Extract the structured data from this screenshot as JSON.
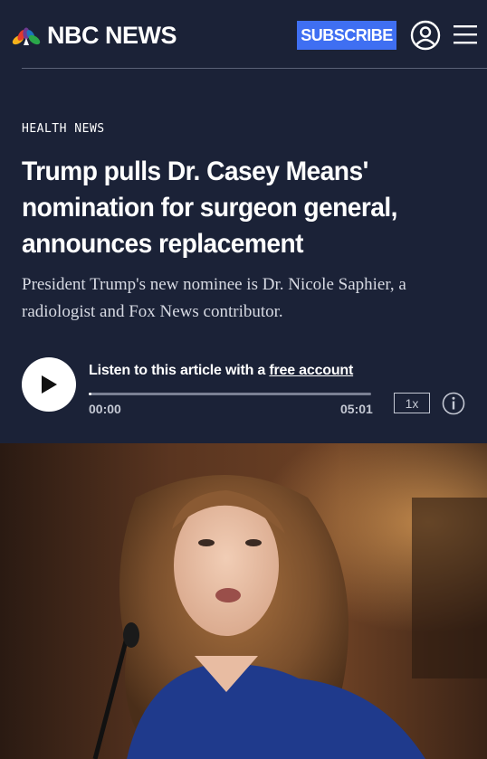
{
  "header": {
    "logo_text": "NBC NEWS",
    "subscribe_label": "SUBSCRIBE",
    "account_icon": "account-icon",
    "menu_icon": "hamburger-menu-icon"
  },
  "article": {
    "kicker": "HEALTH NEWS",
    "headline": "Trump pulls Dr. Casey Means' nomination for surgeon general, announces replacement",
    "dek": "President Trump's new nominee is Dr. Nicole Saphier, a radiologist and Fox News contributor."
  },
  "audio": {
    "listen_text": "Listen to this article with a ",
    "listen_link": "free account",
    "time_current": "00:00",
    "time_total": "05:01",
    "speed": "1x",
    "progress": 0
  },
  "colors": {
    "background": "#1b2237",
    "subscribe": "#3f6ff2"
  }
}
